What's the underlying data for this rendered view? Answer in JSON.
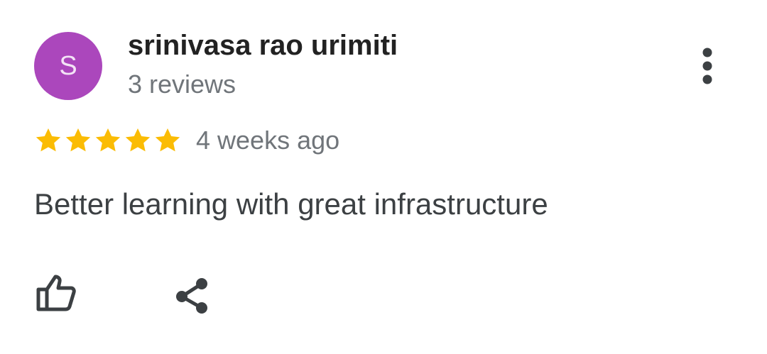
{
  "review": {
    "avatar_letter": "S",
    "avatar_color": "#ab47bc",
    "reviewer_name": "srinivasa rao urimiti",
    "review_count": "3 reviews",
    "rating": 5,
    "rating_max": 5,
    "star_color": "#fbbc04",
    "date": "4 weeks ago",
    "text": "Better learning with great infrastructure"
  },
  "icons": {
    "menu": "more-vert-icon",
    "star": "star-icon",
    "like": "thumb-up-icon",
    "share": "share-icon"
  }
}
